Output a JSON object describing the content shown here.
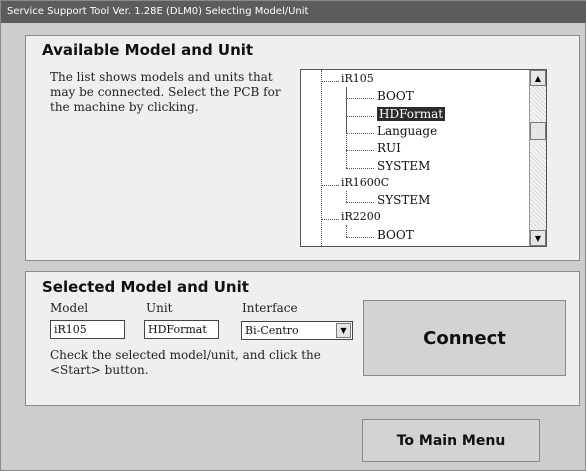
{
  "window": {
    "title": "Service Support Tool Ver. 1.28E (DLM0)   Selecting Model/Unit"
  },
  "available": {
    "heading": "Available Model and Unit",
    "description": "The list shows models and units that may be connected. Select the PCB for the machine by clicking.",
    "tree": [
      {
        "label": "iR105",
        "level": 0
      },
      {
        "label": "BOOT",
        "level": 1
      },
      {
        "label": "HDFormat",
        "level": 1,
        "selected": true
      },
      {
        "label": "Language",
        "level": 1
      },
      {
        "label": "RUI",
        "level": 1
      },
      {
        "label": "SYSTEM",
        "level": 1
      },
      {
        "label": "iR1600C",
        "level": 0
      },
      {
        "label": "SYSTEM",
        "level": 1
      },
      {
        "label": "iR2200",
        "level": 0
      },
      {
        "label": "BOOT",
        "level": 1
      }
    ],
    "scroll_up_icon": "triangle-up",
    "scroll_down_icon": "triangle-down"
  },
  "selected": {
    "heading": "Selected Model and Unit",
    "model_label": "Model",
    "model_value": "iR105",
    "unit_label": "Unit",
    "unit_value": "HDFormat",
    "interface_label": "Interface",
    "interface_value": "Bi-Centro",
    "instruction": "Check the selected model/unit, and click the <Start> button.",
    "connect_label": "Connect"
  },
  "footer": {
    "main_menu_label": "To Main Menu"
  }
}
